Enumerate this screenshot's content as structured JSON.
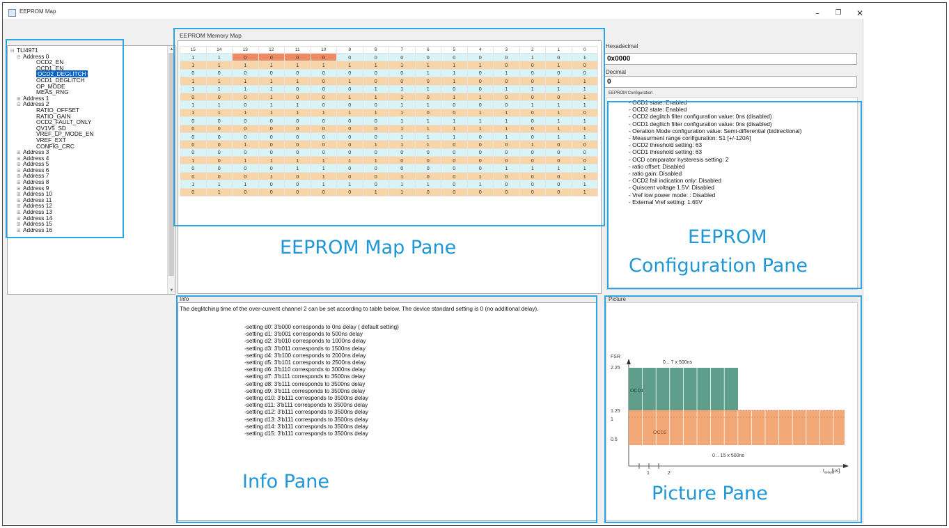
{
  "window": {
    "title": "EEPROM Map",
    "minimize_glyph": "–",
    "maximize_glyph": "❐",
    "close_glyph": "✕"
  },
  "tree": {
    "items": [
      {
        "label": "TLI4971",
        "level": 0,
        "exp": "⊟"
      },
      {
        "label": "Address 0",
        "level": 1,
        "exp": "⊟"
      },
      {
        "label": "OCD2_EN",
        "level": 2,
        "exp": ""
      },
      {
        "label": "OCD1_EN",
        "level": 2,
        "exp": ""
      },
      {
        "label": "OCD2_DEGLITCH",
        "level": 2,
        "exp": "",
        "selected": true
      },
      {
        "label": "OCD1_DEGLITCH",
        "level": 2,
        "exp": ""
      },
      {
        "label": "OP_MODE",
        "level": 2,
        "exp": ""
      },
      {
        "label": "MEAS_RNG",
        "level": 2,
        "exp": ""
      },
      {
        "label": "Address 1",
        "level": 1,
        "exp": "⊞"
      },
      {
        "label": "Address 2",
        "level": 1,
        "exp": "⊟"
      },
      {
        "label": "RATIO_OFFSET",
        "level": 2,
        "exp": ""
      },
      {
        "label": "RATIO_GAIN",
        "level": 2,
        "exp": ""
      },
      {
        "label": "OCD2_FAULT_ONLY",
        "level": 2,
        "exp": ""
      },
      {
        "label": "QV1V5_SD",
        "level": 2,
        "exp": ""
      },
      {
        "label": "VREF_LP_MODE_EN",
        "level": 2,
        "exp": ""
      },
      {
        "label": "VREF_EXT",
        "level": 2,
        "exp": ""
      },
      {
        "label": "CONFIG_CRC",
        "level": 2,
        "exp": ""
      },
      {
        "label": "Address 3",
        "level": 1,
        "exp": "⊞"
      },
      {
        "label": "Address 4",
        "level": 1,
        "exp": "⊞"
      },
      {
        "label": "Address 5",
        "level": 1,
        "exp": "⊞"
      },
      {
        "label": "Address 6",
        "level": 1,
        "exp": "⊞"
      },
      {
        "label": "Address 7",
        "level": 1,
        "exp": "⊞"
      },
      {
        "label": "Address 8",
        "level": 1,
        "exp": "⊞"
      },
      {
        "label": "Address 9",
        "level": 1,
        "exp": "⊞"
      },
      {
        "label": "Address 10",
        "level": 1,
        "exp": "⊞"
      },
      {
        "label": "Address 11",
        "level": 1,
        "exp": "⊞"
      },
      {
        "label": "Address 12",
        "level": 1,
        "exp": "⊞"
      },
      {
        "label": "Address 13",
        "level": 1,
        "exp": "⊞"
      },
      {
        "label": "Address 14",
        "level": 1,
        "exp": "⊞"
      },
      {
        "label": "Address 15",
        "level": 1,
        "exp": "⊞"
      },
      {
        "label": "Address 16",
        "level": 1,
        "exp": "⊞"
      }
    ]
  },
  "map": {
    "title": "EEPROM Memory Map",
    "columns": [
      "15",
      "14",
      "13",
      "12",
      "11",
      "10",
      "9",
      "8",
      "7",
      "6",
      "5",
      "4",
      "3",
      "2",
      "1",
      "0"
    ],
    "rows": [
      [
        "1",
        "1",
        "0",
        "0",
        "0",
        "0",
        "0",
        "0",
        "0",
        "0",
        "0",
        "0",
        "0",
        "1",
        "0",
        "1"
      ],
      [
        "1",
        "1",
        "1",
        "1",
        "1",
        "1",
        "1",
        "1",
        "1",
        "1",
        "1",
        "1",
        "0",
        "0",
        "1",
        "0"
      ],
      [
        "0",
        "0",
        "0",
        "0",
        "0",
        "0",
        "0",
        "0",
        "0",
        "1",
        "1",
        "0",
        "1",
        "0",
        "0",
        "0"
      ],
      [
        "1",
        "1",
        "1",
        "1",
        "1",
        "0",
        "1",
        "0",
        "0",
        "0",
        "1",
        "0",
        "0",
        "0",
        "1",
        "1"
      ],
      [
        "1",
        "1",
        "1",
        "1",
        "0",
        "0",
        "0",
        "1",
        "1",
        "1",
        "0",
        "0",
        "1",
        "1",
        "1",
        "1"
      ],
      [
        "0",
        "0",
        "0",
        "1",
        "0",
        "0",
        "1",
        "1",
        "1",
        "0",
        "1",
        "1",
        "0",
        "0",
        "0",
        "1"
      ],
      [
        "1",
        "1",
        "0",
        "1",
        "1",
        "0",
        "0",
        "0",
        "1",
        "1",
        "0",
        "0",
        "0",
        "1",
        "1",
        "1"
      ],
      [
        "1",
        "1",
        "1",
        "1",
        "1",
        "1",
        "1",
        "1",
        "1",
        "0",
        "0",
        "1",
        "1",
        "0",
        "1",
        "0"
      ],
      [
        "0",
        "0",
        "0",
        "0",
        "0",
        "0",
        "0",
        "0",
        "1",
        "1",
        "1",
        "1",
        "1",
        "0",
        "1",
        "1"
      ],
      [
        "0",
        "0",
        "0",
        "0",
        "0",
        "0",
        "0",
        "0",
        "1",
        "1",
        "1",
        "1",
        "1",
        "0",
        "1",
        "1"
      ],
      [
        "0",
        "0",
        "0",
        "0",
        "0",
        "0",
        "0",
        "0",
        "1",
        "1",
        "1",
        "0",
        "1",
        "0",
        "1",
        "1"
      ],
      [
        "0",
        "0",
        "1",
        "0",
        "0",
        "0",
        "0",
        "1",
        "1",
        "1",
        "0",
        "0",
        "0",
        "1",
        "0",
        "0"
      ],
      [
        "0",
        "0",
        "0",
        "0",
        "0",
        "0",
        "0",
        "0",
        "0",
        "0",
        "0",
        "0",
        "0",
        "0",
        "0",
        "0"
      ],
      [
        "1",
        "0",
        "1",
        "1",
        "1",
        "1",
        "1",
        "1",
        "0",
        "0",
        "0",
        "0",
        "0",
        "0",
        "0",
        "0"
      ],
      [
        "0",
        "0",
        "0",
        "0",
        "1",
        "1",
        "0",
        "0",
        "0",
        "0",
        "0",
        "0",
        "1",
        "1",
        "1",
        "1"
      ],
      [
        "0",
        "0",
        "0",
        "1",
        "0",
        "1",
        "0",
        "0",
        "1",
        "0",
        "0",
        "1",
        "0",
        "0",
        "0",
        "1"
      ],
      [
        "1",
        "1",
        "1",
        "0",
        "0",
        "1",
        "1",
        "0",
        "1",
        "1",
        "0",
        "1",
        "0",
        "0",
        "0",
        "1"
      ],
      [
        "0",
        "1",
        "0",
        "0",
        "0",
        "0",
        "0",
        "1",
        "1",
        "0",
        "0",
        "0",
        "0",
        "0",
        "0",
        "1"
      ]
    ]
  },
  "config": {
    "hex_label": "Hexadecimal",
    "hex_value": "0x0000",
    "dec_label": "Decimal",
    "dec_value": "0",
    "section_label": "EEPROM Configuration",
    "lines": [
      "- OCD1 state: Enabled",
      "- OCD2 state: Enabled",
      "- OCD2 deglitch filter configuration value: 0ns (disabled)",
      "- OCD1 deglitch filter configuration value: 0ns (disabled)",
      "- Oeration Mode configuration value: Semi-differential (bidirectional)",
      "- Measurment range configuration: S1 [+/-120A]",
      "- OCD2 threshold setting: 63",
      "- OCD1 threshold setting: 63",
      "- OCD comparator hysteresis setting: 2",
      "- ratio offset: Disabled",
      "- ratio gain: Disabled",
      "- OCD2 fail indication only: Disabled",
      "- Quiscent voltage 1.5V: Disabled",
      "- Vref low power mode: : Disabled",
      "- External Vref setting: 1.65V"
    ]
  },
  "info": {
    "header": "Info",
    "description": "The deglitching time of the over-current channel 2 can be set according to table below. The device standard setting is 0 (no additional delay).",
    "lines": [
      "-setting d0: 3'b000 corresponds to 0ns delay ( default setting)",
      "-setting d1: 3'b001 corresponds to 500ns delay",
      "-setting d2: 3'b010 corresponds to 1000ns delay",
      "-setting d3: 3'b011 corresponds to 1500ns delay",
      "-setting d4: 3'b100 corresponds to 2000ns delay",
      "-setting d5: 3'b101 corresponds to 2500ns delay",
      "-setting d6: 3'b110 corresponds to 3000ns delay",
      "-setting d7: 3'b111 corresponds to 3500ns delay",
      "-setting d8: 3'b111 corresponds to 3500ns delay",
      "-setting d9: 3'b111 corresponds to 3500ns delay",
      "-setting d10: 3'b111 corresponds to 3500ns delay",
      "-setting d11: 3'b111 corresponds to 3500ns delay",
      "-setting d12: 3'b111 corresponds to 3500ns delay",
      "-setting d13: 3'b111 corresponds to 3500ns delay",
      "-setting d14: 3'b111 corresponds to 3500ns delay",
      "-setting d15: 3'b111 corresponds to 3500ns delay"
    ]
  },
  "picture": {
    "header": "Picture",
    "fsr_label": "FSR",
    "y_ticks": [
      "2.25",
      "1.25",
      "1",
      "0.5"
    ],
    "x_ticks": [
      "1",
      "2"
    ],
    "x_axis_label_main": "t",
    "x_axis_label_sub": "delay",
    "x_axis_label_unit": "[µs]",
    "ocd1_label": "OCD1",
    "ocd2_label": "OCD2",
    "ocd1_range": "0 .. 7 x 500ns",
    "ocd2_range": "0 .. 15 x 500ns",
    "ocd1_color": "#5e9e8a",
    "ocd2_color": "#f3a877"
  },
  "annotations": {
    "map_pane": "EEPROM Map Pane",
    "config_pane_line1": "EEPROM",
    "config_pane_line2": "Configuration Pane",
    "info_pane": "Info Pane",
    "picture_pane": "Picture Pane",
    "highlight_color": "#2aa6e0"
  }
}
